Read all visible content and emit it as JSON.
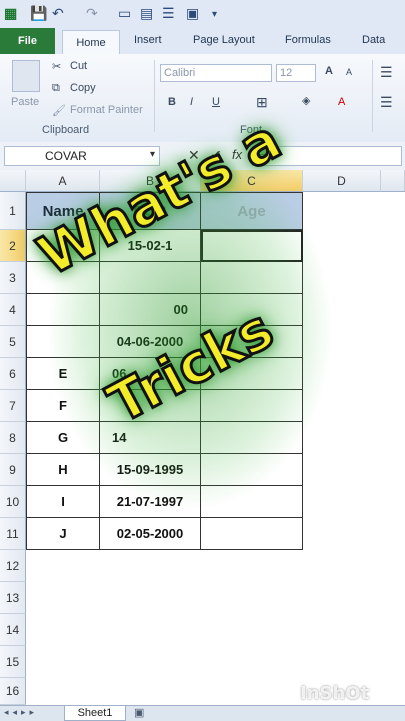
{
  "qat": {
    "save": "💾",
    "undo": "↶",
    "redo": "↷"
  },
  "tabs": {
    "file": "File",
    "home": "Home",
    "insert": "Insert",
    "page_layout": "Page Layout",
    "formulas": "Formulas",
    "data": "Data"
  },
  "ribbon": {
    "paste": "Paste",
    "cut": "Cut",
    "copy": "Copy",
    "format_painter": "Format Painter",
    "clipboard_label": "Clipboard",
    "font_name": "Calibri",
    "font_size": "12",
    "bold": "B",
    "italic": "I",
    "underline": "U",
    "font_label": "Font",
    "grow_font": "A",
    "shrink_font": "A",
    "font_color": "A"
  },
  "formula_bar": {
    "name_box": "COVAR",
    "formula": "="
  },
  "columns": [
    "A",
    "B",
    "C",
    "D"
  ],
  "rows": [
    "1",
    "2",
    "3",
    "4",
    "5",
    "6",
    "7",
    "8",
    "9",
    "10",
    "11",
    "12",
    "13",
    "14",
    "15",
    "16"
  ],
  "table": {
    "headers": [
      "Name",
      "DOB",
      "Age"
    ],
    "rows": [
      {
        "name": "A",
        "dob": "15-02-1"
      },
      {
        "name": "",
        "dob": ""
      },
      {
        "name": "",
        "dob": "00"
      },
      {
        "name": "",
        "dob": "04-06-2000"
      },
      {
        "name": "E",
        "dob": "06"
      },
      {
        "name": "F",
        "dob": ""
      },
      {
        "name": "G",
        "dob": "14"
      },
      {
        "name": "H",
        "dob": "15-09-1995"
      },
      {
        "name": "I",
        "dob": "21-07-1997"
      },
      {
        "name": "J",
        "dob": "02-05-2000"
      }
    ]
  },
  "sheet": {
    "tab": "Sheet1"
  },
  "overlay": {
    "line1": "What's a",
    "line2": "Tricks"
  },
  "watermark": "InShOt",
  "colors": {
    "file_tab": "#2a7a3a",
    "header_fill": "#b9cde4",
    "overlay_text": "#f3ec2a",
    "glow": "#2a9a2a"
  }
}
